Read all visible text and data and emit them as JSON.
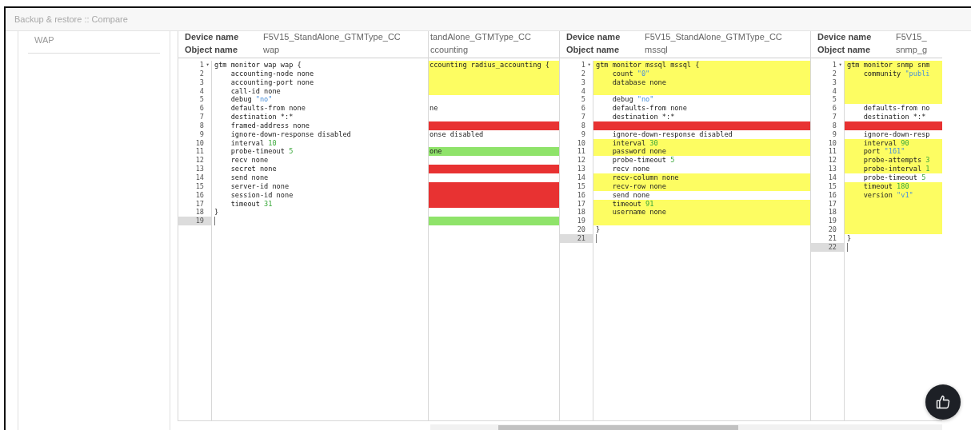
{
  "window": {
    "title": "Backup & restore :: Compare"
  },
  "sidebar": {
    "items": [
      {
        "label": "WAP"
      }
    ]
  },
  "panels": [
    {
      "device_label": "Device name",
      "device_name": "F5V15_StandAlone_GTMType_CC",
      "object_label": "Object name",
      "object_name": "wap",
      "gutter": true,
      "lines": [
        {
          "n": "1",
          "fold": "▾",
          "code": "gtm monitor wap wap {",
          "kind": "plain",
          "active": false
        },
        {
          "n": "2",
          "code": "    accounting-node none",
          "kind": "plain",
          "active": false
        },
        {
          "n": "3",
          "code": "    accounting-port none",
          "kind": "plain",
          "active": false
        },
        {
          "n": "4",
          "code": "    call-id none",
          "kind": "plain",
          "active": false
        },
        {
          "n": "5",
          "code": "    debug ",
          "value": {
            "text": "\"no\"",
            "kind": "string"
          },
          "kind": "plain",
          "active": false
        },
        {
          "n": "6",
          "code": "    defaults-from none",
          "kind": "plain",
          "active": false
        },
        {
          "n": "7",
          "code": "    destination *:*",
          "kind": "plain",
          "active": false
        },
        {
          "n": "8",
          "code": "    framed-address none",
          "kind": "plain",
          "active": false
        },
        {
          "n": "9",
          "code": "    ignore-down-response disabled",
          "kind": "plain",
          "active": false
        },
        {
          "n": "10",
          "code": "    interval ",
          "value": {
            "text": "10",
            "kind": "number"
          },
          "kind": "plain",
          "active": false
        },
        {
          "n": "11",
          "code": "    probe-timeout ",
          "value": {
            "text": "5",
            "kind": "number"
          },
          "kind": "plain",
          "active": false
        },
        {
          "n": "12",
          "code": "    recv none",
          "kind": "plain",
          "active": false
        },
        {
          "n": "13",
          "code": "    secret none",
          "kind": "plain",
          "active": false
        },
        {
          "n": "14",
          "code": "    send none",
          "kind": "plain",
          "active": false
        },
        {
          "n": "15",
          "code": "    server-id none",
          "kind": "plain",
          "active": false
        },
        {
          "n": "16",
          "code": "    session-id none",
          "kind": "plain",
          "active": false
        },
        {
          "n": "17",
          "code": "    timeout ",
          "value": {
            "text": "31",
            "kind": "number"
          },
          "kind": "plain",
          "active": false
        },
        {
          "n": "18",
          "code": "}",
          "kind": "plain",
          "active": false
        },
        {
          "n": "19",
          "kind": "plain",
          "active": true
        }
      ]
    },
    {
      "device_name": "tandAlone_GTMType_CC",
      "object_name": "ccounting",
      "gutter": false,
      "lines": [
        {
          "code": "ccounting radius_accounting {",
          "kind": "changed"
        },
        {
          "kind": "changed"
        },
        {
          "kind": "changed"
        },
        {
          "kind": "changed"
        },
        {
          "kind": "plain"
        },
        {
          "code": "ne",
          "kind": "plain"
        },
        {
          "kind": "plain"
        },
        {
          "kind": "removed"
        },
        {
          "code": "onse disabled",
          "kind": "plain"
        },
        {
          "kind": "plain"
        },
        {
          "code": "one",
          "kind": "added"
        },
        {
          "kind": "plain"
        },
        {
          "kind": "removed"
        },
        {
          "kind": "plain"
        },
        {
          "kind": "removed"
        },
        {
          "kind": "removed"
        },
        {
          "kind": "removed"
        },
        {
          "kind": "plain"
        },
        {
          "kind": "added"
        }
      ]
    },
    {
      "device_label": "Device name",
      "device_name": "F5V15_StandAlone_GTMType_CC",
      "object_label": "Object name",
      "object_name": "mssql",
      "gutter": true,
      "lines": [
        {
          "n": "1",
          "fold": "▾",
          "code": "gtm monitor mssql mssql {",
          "kind": "changed",
          "active": false
        },
        {
          "n": "2",
          "code": "    count ",
          "value": {
            "text": "\"0\"",
            "kind": "string"
          },
          "kind": "changed",
          "active": false
        },
        {
          "n": "3",
          "code": "    database none",
          "kind": "changed",
          "active": false
        },
        {
          "n": "4",
          "kind": "changed",
          "active": false
        },
        {
          "n": "5",
          "code": "    debug ",
          "value": {
            "text": "\"no\"",
            "kind": "string"
          },
          "kind": "plain",
          "active": false
        },
        {
          "n": "6",
          "code": "    defaults-from none",
          "kind": "plain",
          "active": false
        },
        {
          "n": "7",
          "code": "    destination *:*",
          "kind": "plain",
          "active": false
        },
        {
          "n": "8",
          "kind": "removed",
          "active": false
        },
        {
          "n": "9",
          "code": "    ignore-down-response disabled",
          "kind": "plain",
          "active": false
        },
        {
          "n": "10",
          "code": "    interval ",
          "value": {
            "text": "30",
            "kind": "number"
          },
          "kind": "changed",
          "active": false
        },
        {
          "n": "11",
          "code": "    password none",
          "kind": "changed",
          "active": false
        },
        {
          "n": "12",
          "code": "    probe-timeout ",
          "value": {
            "text": "5",
            "kind": "number"
          },
          "kind": "plain",
          "active": false
        },
        {
          "n": "13",
          "code": "    recv none",
          "kind": "plain",
          "active": false
        },
        {
          "n": "14",
          "code": "    recv-column none",
          "kind": "changed",
          "active": false
        },
        {
          "n": "15",
          "code": "    recv-row none",
          "kind": "changed",
          "active": false
        },
        {
          "n": "16",
          "code": "    send none",
          "kind": "plain",
          "active": false
        },
        {
          "n": "17",
          "code": "    timeout ",
          "value": {
            "text": "91",
            "kind": "number"
          },
          "kind": "changed",
          "active": false
        },
        {
          "n": "18",
          "code": "    username none",
          "kind": "changed",
          "active": false
        },
        {
          "n": "19",
          "kind": "changed",
          "active": false
        },
        {
          "n": "20",
          "code": "}",
          "kind": "plain",
          "active": false
        },
        {
          "n": "21",
          "kind": "plain",
          "active": true
        }
      ]
    },
    {
      "device_label": "Device name",
      "device_name": "F5V15_",
      "object_label": "Object name",
      "object_name": "snmp_g",
      "gutter": true,
      "lines": [
        {
          "n": "1",
          "fold": "▾",
          "code": "gtm monitor snmp snm",
          "kind": "changed",
          "active": false
        },
        {
          "n": "2",
          "code": "    community ",
          "value": {
            "text": "\"publi",
            "kind": "string"
          },
          "kind": "changed",
          "active": false
        },
        {
          "n": "3",
          "kind": "changed",
          "active": false
        },
        {
          "n": "4",
          "kind": "changed",
          "active": false
        },
        {
          "n": "5",
          "kind": "changed",
          "active": false
        },
        {
          "n": "6",
          "code": "    defaults-from no",
          "kind": "plain",
          "active": false
        },
        {
          "n": "7",
          "code": "    destination *:*",
          "kind": "plain",
          "active": false
        },
        {
          "n": "8",
          "kind": "removed",
          "active": false
        },
        {
          "n": "9",
          "code": "    ignore-down-resp",
          "kind": "plain",
          "active": false
        },
        {
          "n": "10",
          "code": "    interval ",
          "value": {
            "text": "90",
            "kind": "number"
          },
          "kind": "changed",
          "active": false
        },
        {
          "n": "11",
          "code": "    port ",
          "value": {
            "text": "\"161\"",
            "kind": "string"
          },
          "kind": "changed",
          "active": false
        },
        {
          "n": "12",
          "code": "    probe-attempts ",
          "value": {
            "text": "3",
            "kind": "number"
          },
          "kind": "changed",
          "active": false
        },
        {
          "n": "13",
          "code": "    probe-interval ",
          "value": {
            "text": "1",
            "kind": "number"
          },
          "kind": "changed",
          "active": false
        },
        {
          "n": "14",
          "code": "    probe-timeout ",
          "value": {
            "text": "5",
            "kind": "number"
          },
          "kind": "plain",
          "active": false
        },
        {
          "n": "15",
          "code": "    timeout ",
          "value": {
            "text": "180",
            "kind": "number"
          },
          "kind": "changed",
          "active": false
        },
        {
          "n": "16",
          "code": "    version ",
          "value": {
            "text": "\"v1\"",
            "kind": "string"
          },
          "kind": "changed",
          "active": false
        },
        {
          "n": "17",
          "kind": "changed",
          "active": false
        },
        {
          "n": "18",
          "kind": "changed",
          "active": false
        },
        {
          "n": "19",
          "kind": "changed",
          "active": false
        },
        {
          "n": "20",
          "kind": "changed",
          "active": false
        },
        {
          "n": "21",
          "code": "}",
          "kind": "plain",
          "active": false
        },
        {
          "n": "22",
          "kind": "plain",
          "active": true
        }
      ]
    }
  ]
}
